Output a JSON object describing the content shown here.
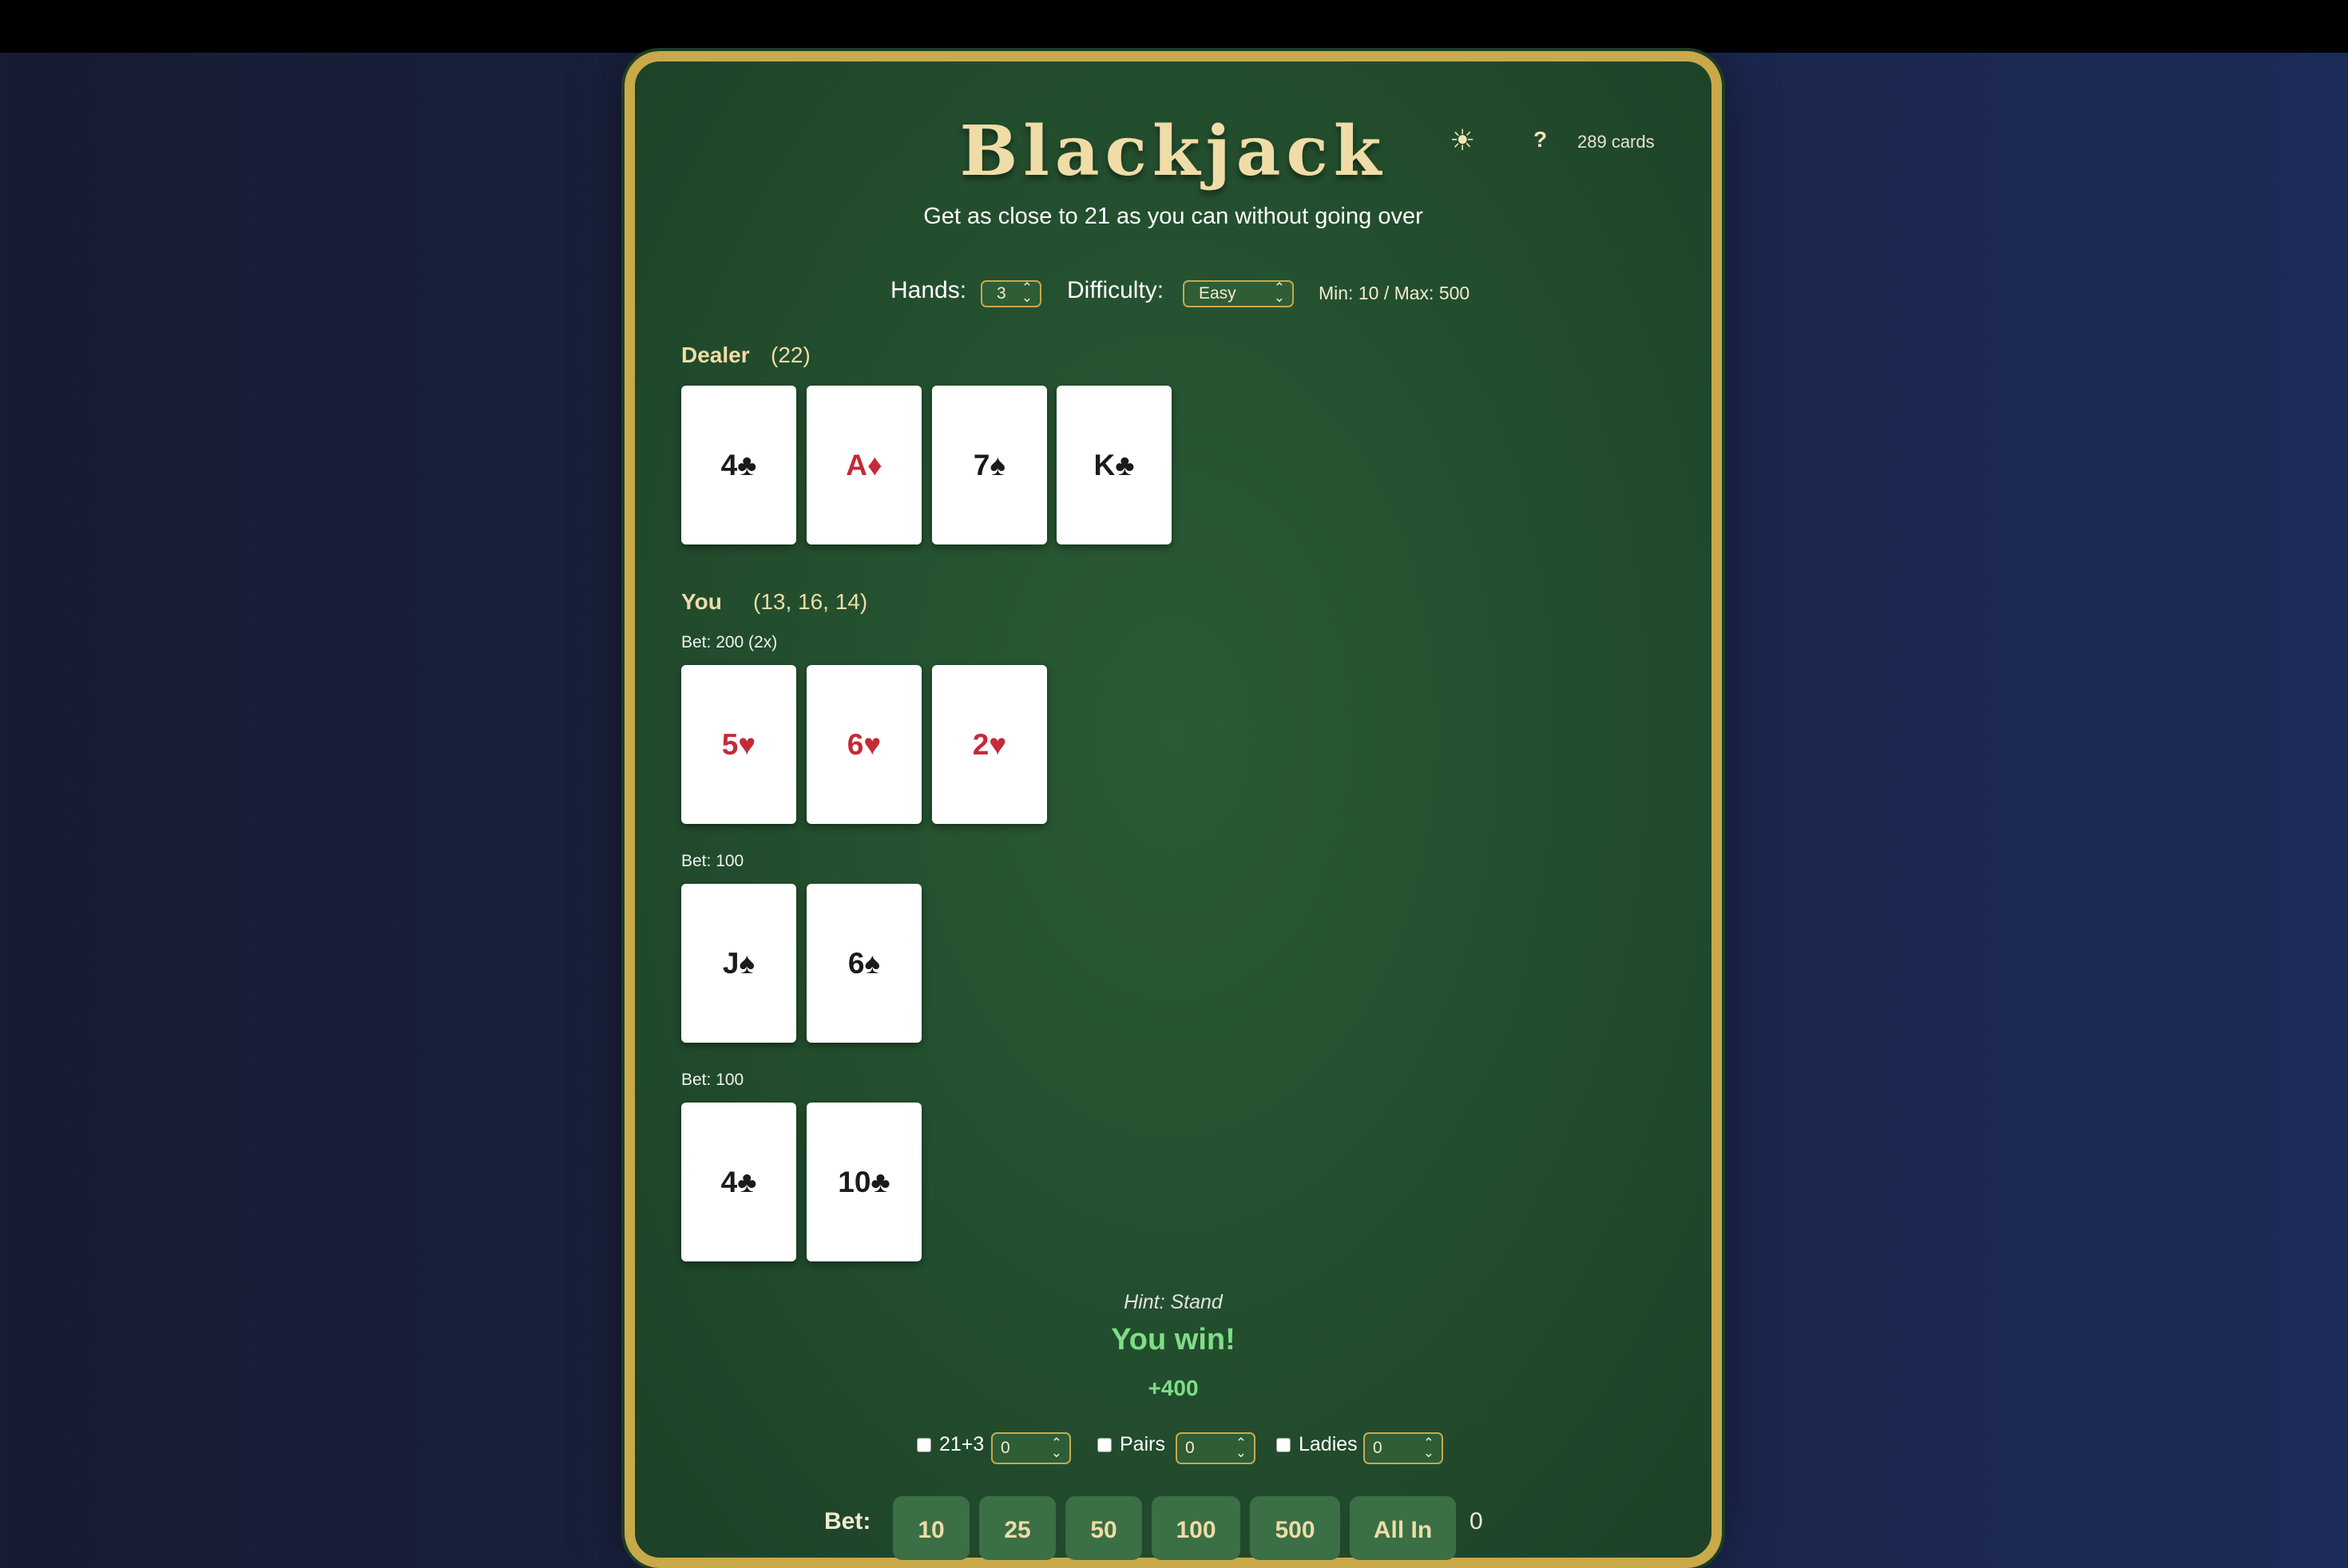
{
  "header": {
    "title": "Blackjack",
    "subtitle": "Get as close to 21 as you can without going over",
    "theme_icon": "☀",
    "help_label": "?",
    "cards_remaining": "289 cards"
  },
  "controls": {
    "hands_label": "Hands:",
    "hands_value": "3",
    "difficulty_label": "Difficulty:",
    "difficulty_value": "Easy",
    "limits": "Min: 10 / Max: 500"
  },
  "dealer": {
    "label": "Dealer",
    "score": "(22)",
    "cards": [
      {
        "text": "4♣",
        "color": "black"
      },
      {
        "text": "A♦",
        "color": "red"
      },
      {
        "text": "7♠",
        "color": "black"
      },
      {
        "text": "K♣",
        "color": "black"
      }
    ]
  },
  "player": {
    "label": "You",
    "score": "(13, 16, 14)",
    "hands": [
      {
        "bet": "Bet: 200 (2x)",
        "cards": [
          {
            "text": "5♥",
            "color": "red"
          },
          {
            "text": "6♥",
            "color": "red"
          },
          {
            "text": "2♥",
            "color": "red"
          }
        ]
      },
      {
        "bet": "Bet: 100",
        "cards": [
          {
            "text": "J♠",
            "color": "black"
          },
          {
            "text": "6♠",
            "color": "black"
          }
        ]
      },
      {
        "bet": "Bet: 100",
        "cards": [
          {
            "text": "4♣",
            "color": "black"
          },
          {
            "text": "10♣",
            "color": "black"
          }
        ]
      }
    ]
  },
  "status": {
    "hint": "Hint: Stand",
    "result": "You win!",
    "payout": "+400"
  },
  "side_bets": [
    {
      "label": "21+3",
      "value": "0",
      "checked": false
    },
    {
      "label": "Pairs",
      "value": "0",
      "checked": false
    },
    {
      "label": "Ladies",
      "value": "0",
      "checked": false
    }
  ],
  "betting": {
    "label": "Bet:",
    "chips": [
      "10",
      "25",
      "50",
      "100",
      "500",
      "All In"
    ],
    "current_bet": "0"
  },
  "colors": {
    "felt": "#24502f",
    "rail": "#c9a94a",
    "gold_text": "#efdca7",
    "win_green": "#7ede86",
    "red_suit": "#c42a38"
  }
}
